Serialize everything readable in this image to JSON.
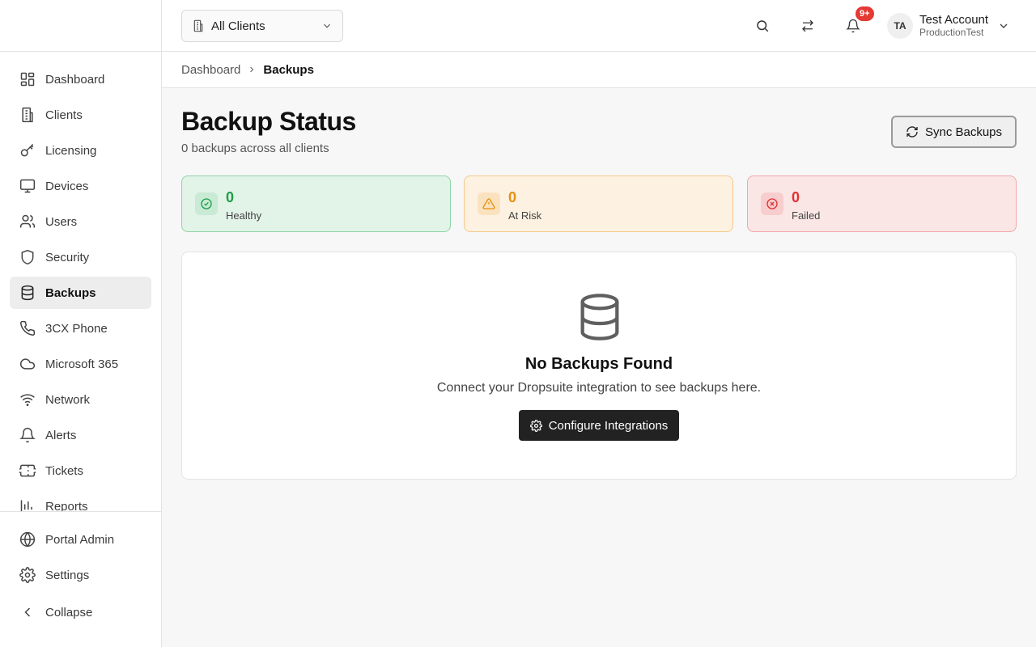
{
  "header": {
    "client_select": "All Clients",
    "notification_count": "9+",
    "avatar_initials": "TA",
    "account_name": "Test Account",
    "account_org": "ProductionTest"
  },
  "sidebar": {
    "items": [
      {
        "label": "Dashboard",
        "icon": "dashboard-icon"
      },
      {
        "label": "Clients",
        "icon": "building-icon"
      },
      {
        "label": "Licensing",
        "icon": "key-icon"
      },
      {
        "label": "Devices",
        "icon": "monitor-icon"
      },
      {
        "label": "Users",
        "icon": "users-icon"
      },
      {
        "label": "Security",
        "icon": "shield-icon"
      },
      {
        "label": "Backups",
        "icon": "database-icon",
        "active": true
      },
      {
        "label": "3CX Phone",
        "icon": "phone-icon"
      },
      {
        "label": "Microsoft 365",
        "icon": "cloud-icon"
      },
      {
        "label": "Network",
        "icon": "wifi-icon"
      },
      {
        "label": "Alerts",
        "icon": "bell-icon"
      },
      {
        "label": "Tickets",
        "icon": "ticket-icon"
      },
      {
        "label": "Reports",
        "icon": "bar-chart-icon"
      }
    ],
    "bottom": {
      "portal_admin": "Portal Admin",
      "settings": "Settings",
      "collapse": "Collapse"
    }
  },
  "breadcrumb": {
    "parent": "Dashboard",
    "current": "Backups"
  },
  "main": {
    "title": "Backup Status",
    "subtitle": "0 backups across all clients",
    "sync_label": "Sync Backups",
    "stats": {
      "healthy": {
        "value": "0",
        "label": "Healthy",
        "color": "#1f9d4a"
      },
      "at_risk": {
        "value": "0",
        "label": "At Risk",
        "color": "#e6900c"
      },
      "failed": {
        "value": "0",
        "label": "Failed",
        "color": "#e03131"
      }
    },
    "empty": {
      "title": "No Backups Found",
      "description": "Connect your Dropsuite integration to see backups here.",
      "button": "Configure Integrations"
    }
  }
}
